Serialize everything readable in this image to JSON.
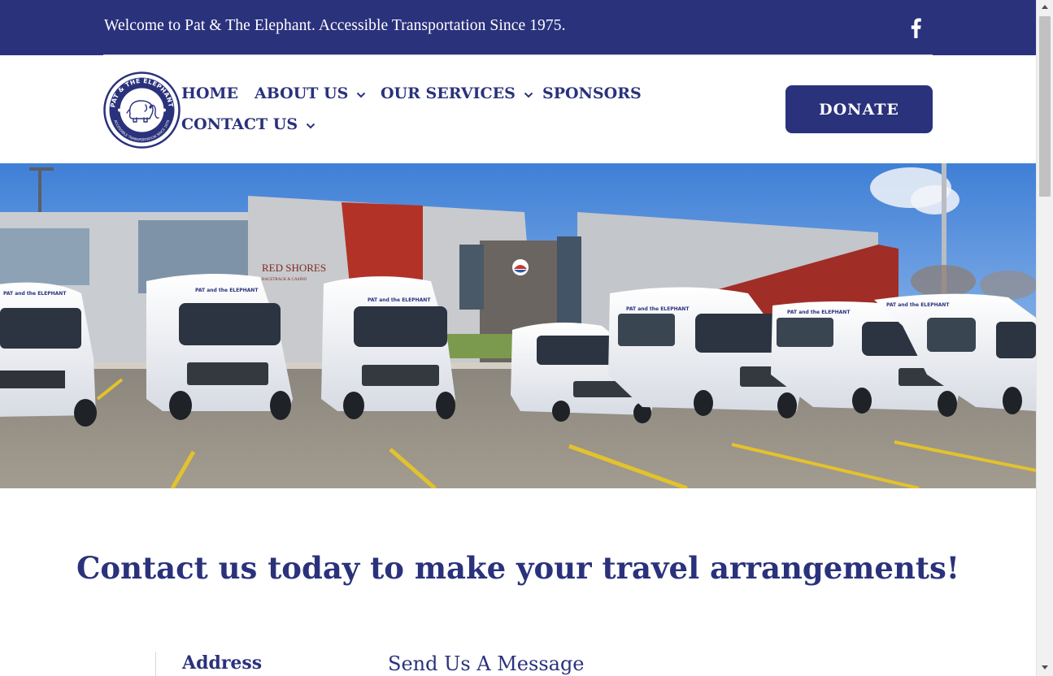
{
  "topbar": {
    "welcome": "Welcome to Pat & The Elephant. Accessible Transportation Since 1975.",
    "social_icon": "facebook-icon"
  },
  "logo": {
    "name": "pat-and-the-elephant-logo",
    "text_top": "PAT & THE ELEPHANT",
    "text_bottom": "ACCESSIBLE TRANSPORTATION SINCE 1975"
  },
  "nav": {
    "home": "HOME",
    "about": "ABOUT US",
    "services": "OUR SERVICES",
    "sponsors": "SPONSORS",
    "contact": "CONTACT US"
  },
  "donate_label": "DONATE",
  "hero": {
    "building_sign": "RED SHORES",
    "building_sign_sub": "RACETRACK & CASINO",
    "van_text": "PAT and the ELEPHANT"
  },
  "content": {
    "title": "Contact us today to make your travel arrangements!",
    "address_heading": "Address",
    "message_heading": "Send Us A Message"
  },
  "colors": {
    "brand_navy": "#2a327c",
    "white": "#ffffff"
  }
}
